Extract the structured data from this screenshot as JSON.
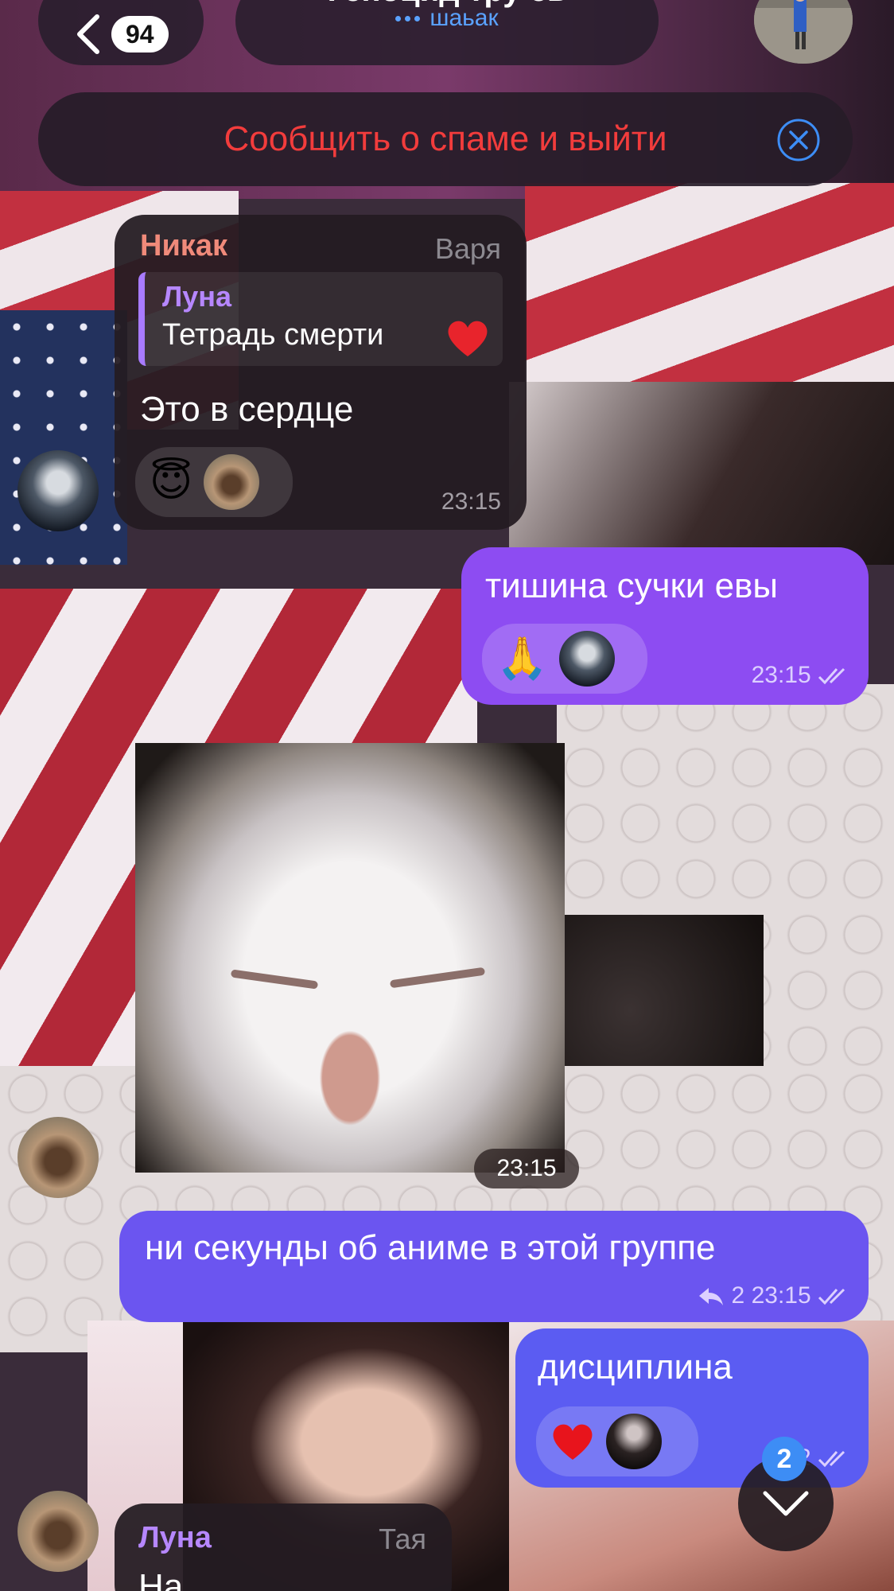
{
  "header": {
    "unread_count": "94",
    "chat_title": "Геноцид тру ев",
    "typing_status": "шаьак"
  },
  "spam_bar": {
    "label": "Сообщить о спаме и выйти"
  },
  "messages": [
    {
      "sender": "Никак",
      "role": "Варя",
      "reply": {
        "name": "Луна",
        "text": "Тетрадь смерти"
      },
      "text": "Это в сердце",
      "reactions": [
        "😇"
      ],
      "time": "23:15"
    },
    {
      "text": "тишина сучки евы",
      "reactions": [
        "🙏"
      ],
      "time": "23:15"
    },
    {
      "type": "photo",
      "time": "23:15"
    },
    {
      "text": "ни секунды об аниме в этой группе",
      "replies_count": "2",
      "time": "23:15"
    },
    {
      "text": "дисциплина",
      "time": "2"
    },
    {
      "sender": "Луна",
      "role": "Тая",
      "text": "На"
    }
  ],
  "scroll_badge": "2",
  "colors": {
    "spam_red": "#f23c3c",
    "outgoing_purple": "#8d4cf2",
    "outgoing_blue": "#5b5cf2",
    "link_blue": "#5aa2ff",
    "sender_nikak": "#f08a7a",
    "sender_luna": "#b687ff"
  },
  "icons": [
    "back-chevron-icon",
    "close-circle-icon",
    "reply-arrow-icon",
    "pin-icon",
    "read-checks-icon",
    "chevron-down-icon",
    "heart-icon"
  ]
}
